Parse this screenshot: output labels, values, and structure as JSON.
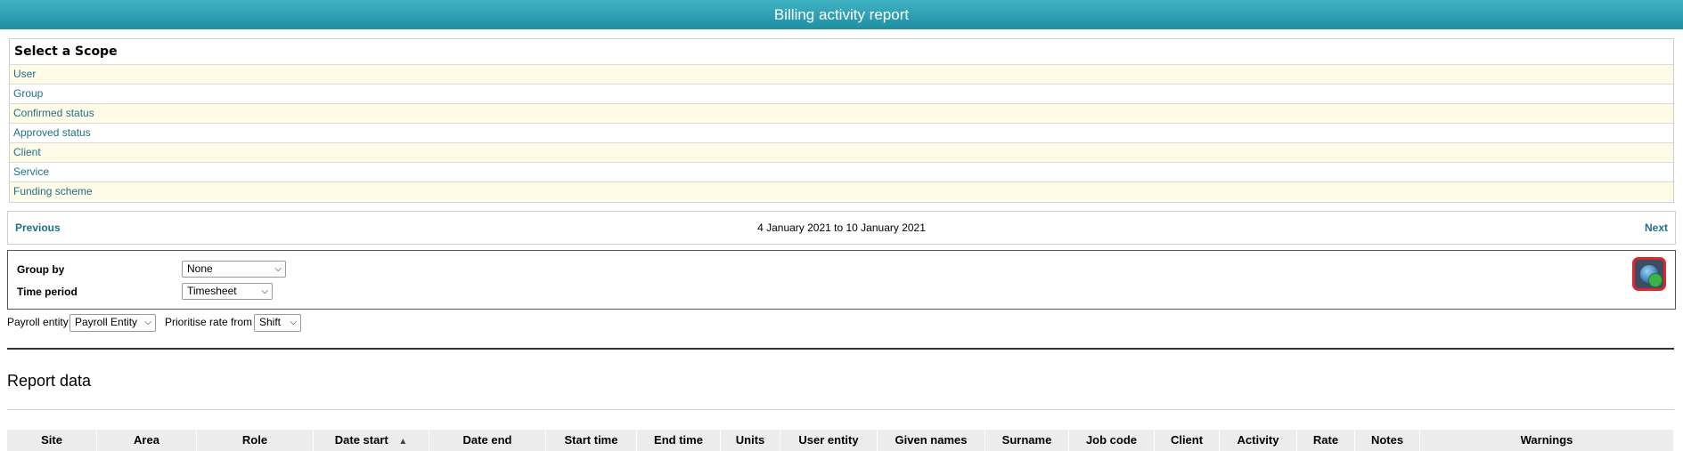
{
  "header": {
    "title": "Billing activity report"
  },
  "scope": {
    "title": "Select a Scope",
    "items": [
      "User",
      "Group",
      "Confirmed status",
      "Approved status",
      "Client",
      "Service",
      "Funding scheme"
    ]
  },
  "nav": {
    "previous": "Previous",
    "range": "4 January 2021 to 10 January 2021",
    "next": "Next"
  },
  "options": {
    "group_by_label": "Group by",
    "group_by_value": "None",
    "time_period_label": "Time period",
    "time_period_value": "Timesheet",
    "payroll_entity_label": "Payroll entity",
    "payroll_entity_value": "Payroll Entity",
    "prioritise_label": "Prioritise rate from",
    "prioritise_value": "Shift",
    "refresh_icon": "refresh-globe-icon"
  },
  "report": {
    "title": "Report data",
    "columns": [
      "Site",
      "Area",
      "Role",
      "Date start",
      "Date end",
      "Start time",
      "End time",
      "Units",
      "User entity",
      "Given names",
      "Surname",
      "Job code",
      "Client",
      "Activity",
      "Rate",
      "Notes",
      "Warnings"
    ],
    "sorted_column": "Date start",
    "sort_direction": "ascending"
  },
  "colors": {
    "header_bg": "#1f8fa2",
    "link": "#1f6f8b",
    "row_alt": "#fffbe6",
    "refresh_border": "#e0262b"
  }
}
